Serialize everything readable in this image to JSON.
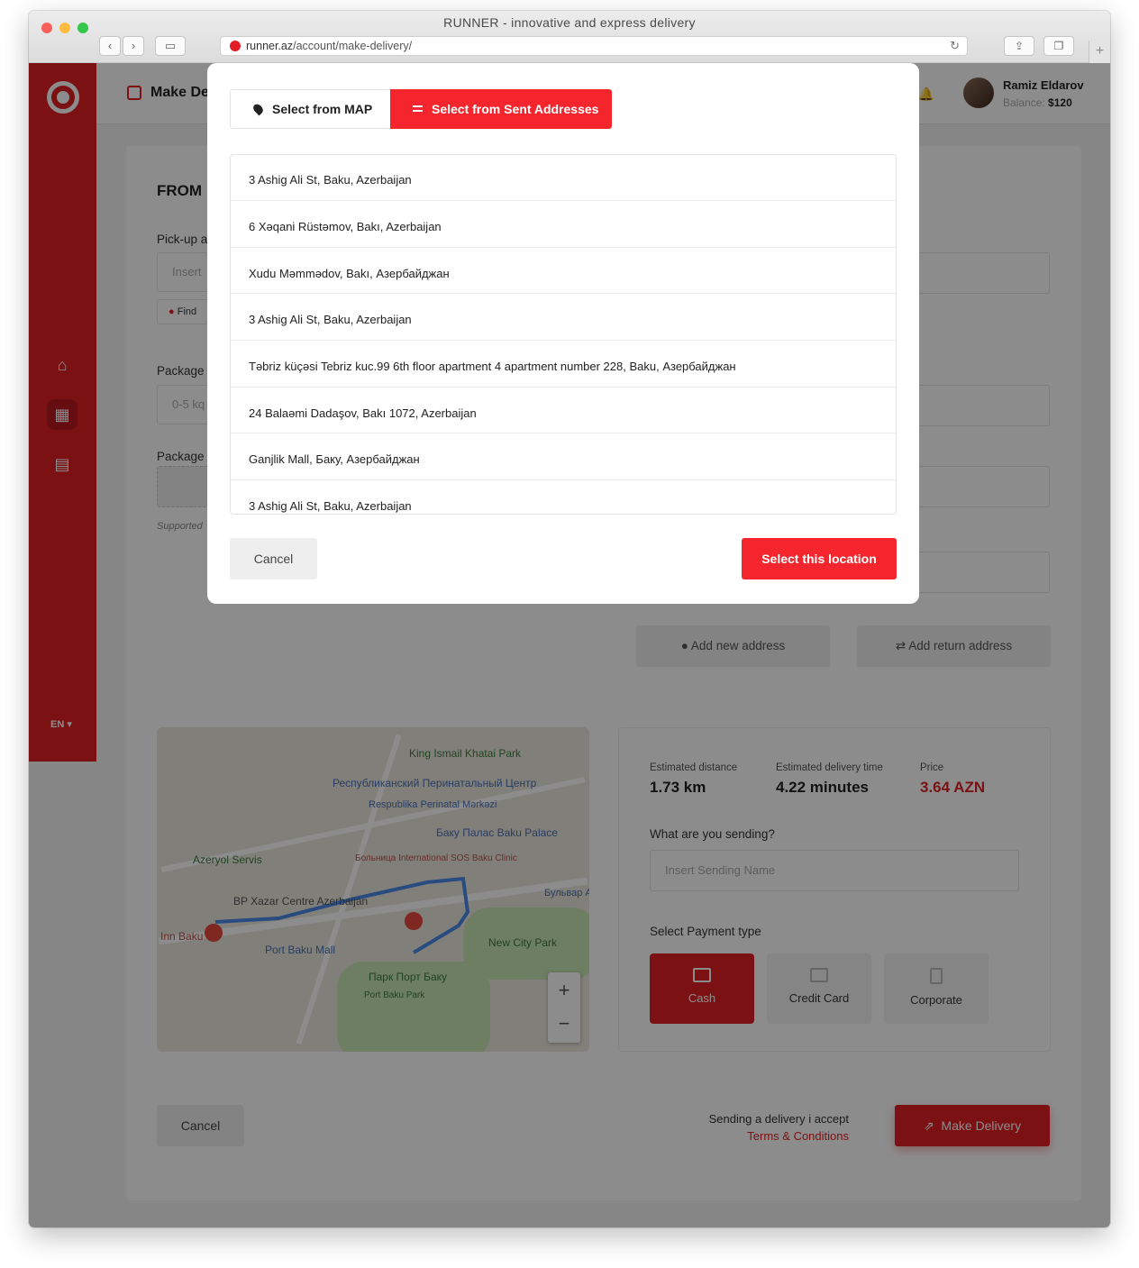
{
  "browser": {
    "window_title": "RUNNER - innovative and express delivery",
    "url_domain": "runner.az",
    "url_path": "/account/make-delivery/"
  },
  "sidebar": {
    "lang": "EN"
  },
  "topbar": {
    "title": "Make De",
    "user_name": "Ramiz Eldarov",
    "balance_label": "Balance:",
    "balance_value": "$120"
  },
  "form": {
    "from_title": "FROM",
    "pickup_label": "Pick-up a",
    "pickup_placeholder": "Insert",
    "find_label": "Find",
    "package_weight_label": "Package",
    "weight_value": "0-5 kq",
    "package_label2": "Package",
    "supported": "Supported",
    "add_new_address": "Add new address",
    "add_return_address": "Add return  address"
  },
  "map": {
    "labels": [
      "King Ismail Khatai Park",
      "Республиканский Перинатальный Центр",
      "Respublika Perinatal Mərkəzi",
      "Azeryol Servis",
      "Больница International SOS Baku Clinic",
      "Баку Палас Baku Palace",
      "BP Xazar Centre Azerbaijan",
      "Port Baku Mall",
      "New City Park",
      "Парк Порт Баку",
      "Port Baku Park",
      "Inn Baku",
      "Бульвар Ağ Şəhər"
    ]
  },
  "summary": {
    "distance_label": "Estimated distance",
    "distance_value": "1.73 km",
    "time_label": "Estimated delivery time",
    "time_value": "4.22 minutes",
    "price_label": "Price",
    "price_value": "3.64 AZN",
    "sending_question": "What are you sending?",
    "sending_placeholder": "Insert Sending Name",
    "payment_label": "Select Payment type",
    "payment_options": [
      "Cash",
      "Credit Card",
      "Corporate"
    ]
  },
  "footer": {
    "cancel": "Cancel",
    "terms_text": "Sending a delivery i accept",
    "terms_link": "Terms & Conditions",
    "make_delivery": "Make Delivery"
  },
  "modal": {
    "tab_map": "Select from MAP",
    "tab_sent": "Select from Sent Addresses",
    "addresses": [
      "3 Ashig Ali St, Baku, Azerbaijan",
      "6 Xəqani Rüstəmov, Bakı, Azerbaijan",
      "Xudu Məmmədov, Bakı, Азербайджан",
      "3 Ashig Ali St, Baku, Azerbaijan",
      "Təbriz küçəsi Tebriz kuc.99 6th floor apartment 4 apartment number 228, Baku, Азербайджан",
      "24 Balaəmi Dadaşov, Bakı 1072, Azerbaijan",
      "Ganjlik Mall, Баку, Азербайджан",
      "3 Ashig Ali St, Baku, Azerbaijan"
    ],
    "cancel": "Cancel",
    "select_location": "Select this location"
  }
}
